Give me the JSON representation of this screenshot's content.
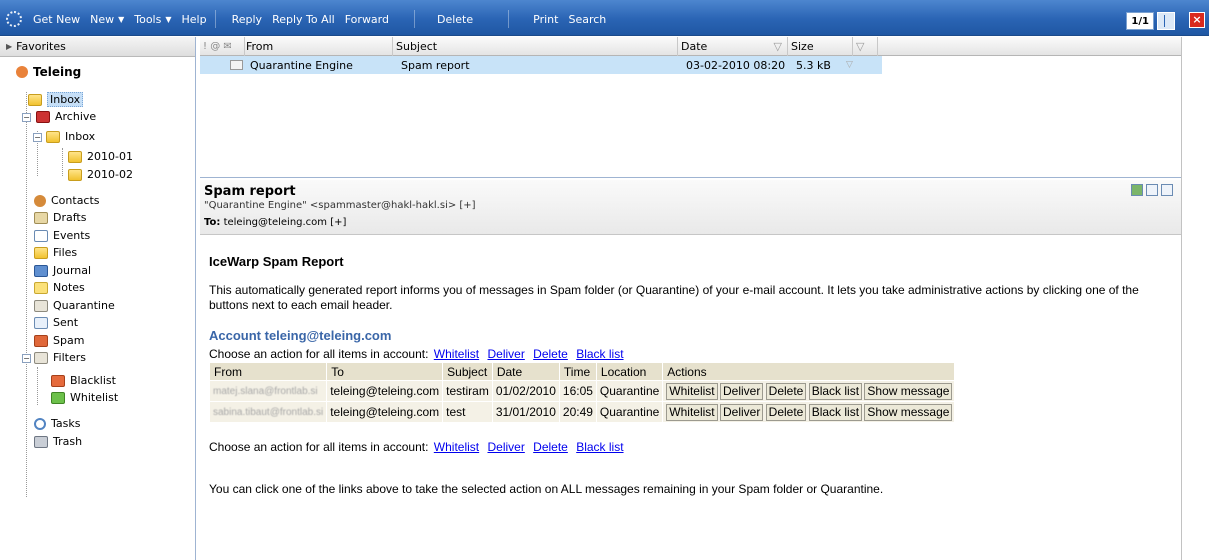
{
  "toolbar": {
    "get_new": "Get New",
    "new": "New",
    "tools": "Tools",
    "help": "Help",
    "reply": "Reply",
    "reply_all": "Reply To All",
    "forward": "Forward",
    "delete": "Delete",
    "print": "Print",
    "search": "Search",
    "pager": "1/1"
  },
  "sidebar": {
    "favorites": "Favorites",
    "account": "Teleing",
    "items": [
      {
        "label": "Inbox",
        "icon": "inbox-icon"
      },
      {
        "label": "Archive",
        "icon": "archive-icon"
      },
      {
        "label": "Inbox",
        "icon": "folder-icon"
      },
      {
        "label": "2010-01",
        "icon": "folder-icon"
      },
      {
        "label": "2010-02",
        "icon": "folder-icon"
      },
      {
        "label": "Contacts",
        "icon": "contacts-icon"
      },
      {
        "label": "Drafts",
        "icon": "drafts-icon"
      },
      {
        "label": "Events",
        "icon": "events-icon"
      },
      {
        "label": "Files",
        "icon": "files-icon"
      },
      {
        "label": "Journal",
        "icon": "journal-icon"
      },
      {
        "label": "Notes",
        "icon": "notes-icon"
      },
      {
        "label": "Quarantine",
        "icon": "quarantine-icon"
      },
      {
        "label": "Sent",
        "icon": "sent-icon"
      },
      {
        "label": "Spam",
        "icon": "spam-icon"
      },
      {
        "label": "Filters",
        "icon": "filters-icon"
      },
      {
        "label": "Blacklist",
        "icon": "blacklist-icon"
      },
      {
        "label": "Whitelist",
        "icon": "whitelist-icon"
      },
      {
        "label": "Tasks",
        "icon": "tasks-icon"
      },
      {
        "label": "Trash",
        "icon": "trash-icon"
      }
    ]
  },
  "message_list": {
    "columns": {
      "from": "From",
      "subject": "Subject",
      "date": "Date",
      "size": "Size"
    },
    "rows": [
      {
        "from": "Quarantine Engine",
        "subject": "Spam report",
        "date": "03-02-2010 08:20",
        "size": "5.3 kB"
      }
    ]
  },
  "preview": {
    "subject": "Spam report",
    "from": "\"Quarantine Engine\" <spammaster@hakl-hakl.si> [+]",
    "to_label": "To:",
    "to": "teleing@teleing.com [+]"
  },
  "report": {
    "title": "IceWarp Spam Report",
    "intro": "This automatically generated report informs you of messages in Spam folder (or Quarantine) of your e-mail account. It lets you take administrative actions by clicking one of the buttons next to each email header.",
    "account_heading": "Account teleing@teleing.com",
    "choose_text": "Choose an action for all items in account:",
    "links": {
      "whitelist": "Whitelist",
      "deliver": "Deliver",
      "delete": "Delete",
      "blacklist": "Black list"
    },
    "table_headers": {
      "from": "From",
      "to": "To",
      "subject": "Subject",
      "date": "Date",
      "time": "Time",
      "location": "Location",
      "actions": "Actions"
    },
    "rows": [
      {
        "from": "matej.slana@frontlab.si",
        "to": "teleing@teleing.com",
        "subject": "testiram",
        "date": "01/02/2010",
        "time": "16:05",
        "location": "Quarantine"
      },
      {
        "from": "sabina.tibaut@frontlab.si",
        "to": "teleing@teleing.com",
        "subject": "test",
        "date": "31/01/2010",
        "time": "20:49",
        "location": "Quarantine"
      }
    ],
    "row_buttons": {
      "whitelist": "Whitelist",
      "deliver": "Deliver",
      "delete": "Delete",
      "blacklist": "Black list",
      "show": "Show message"
    },
    "footer": "You can click one of the links above to take the selected action on ALL messages remaining in your Spam folder or Quarantine."
  }
}
